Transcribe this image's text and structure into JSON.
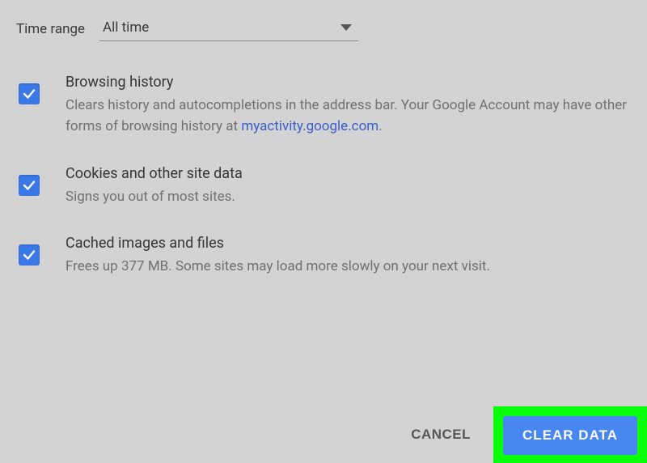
{
  "timeRange": {
    "label": "Time range",
    "value": "All time"
  },
  "options": [
    {
      "title": "Browsing history",
      "descPrefix": "Clears history and autocompletions in the address bar. Your Google Account may have other forms of browsing history at ",
      "link": "myactivity.google.com",
      "descSuffix": "."
    },
    {
      "title": "Cookies and other site data",
      "desc": "Signs you out of most sites."
    },
    {
      "title": "Cached images and files",
      "desc": "Frees up 377 MB. Some sites may load more slowly on your next visit."
    }
  ],
  "buttons": {
    "cancel": "CANCEL",
    "clear": "CLEAR DATA"
  }
}
